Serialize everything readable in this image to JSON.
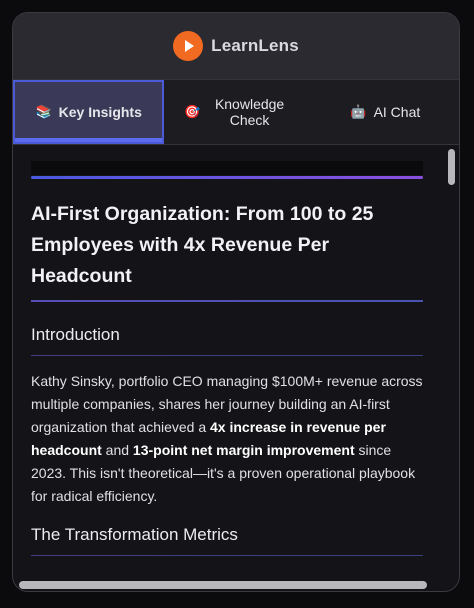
{
  "app": {
    "name": "LearnLens",
    "logo_icon": "play-icon",
    "accent_color": "#f06a22"
  },
  "tabs": [
    {
      "emoji": "📚",
      "label": "Key Insights",
      "active": true
    },
    {
      "emoji": "🎯",
      "label": "Knowledge Check",
      "active": false
    },
    {
      "emoji": "🤖",
      "label": "AI Chat",
      "active": false
    }
  ],
  "article": {
    "title": "AI-First Organization: From 100 to 25 Employees with 4x Revenue Per Headcount",
    "sections": [
      {
        "heading": "Introduction"
      },
      {
        "heading": "The Transformation Metrics"
      }
    ],
    "intro": {
      "t1": "Kathy Sinsky, portfolio CEO managing $100M+ revenue across multiple companies, shares her journey building an AI-first organization that achieved a ",
      "b1": "4x increase in revenue per headcount",
      "t2": " and ",
      "b2": "13-point net margin improvement",
      "t3": " since 2023. This isn't theoretical—it's a proven operational playbook for radical efficiency."
    }
  }
}
